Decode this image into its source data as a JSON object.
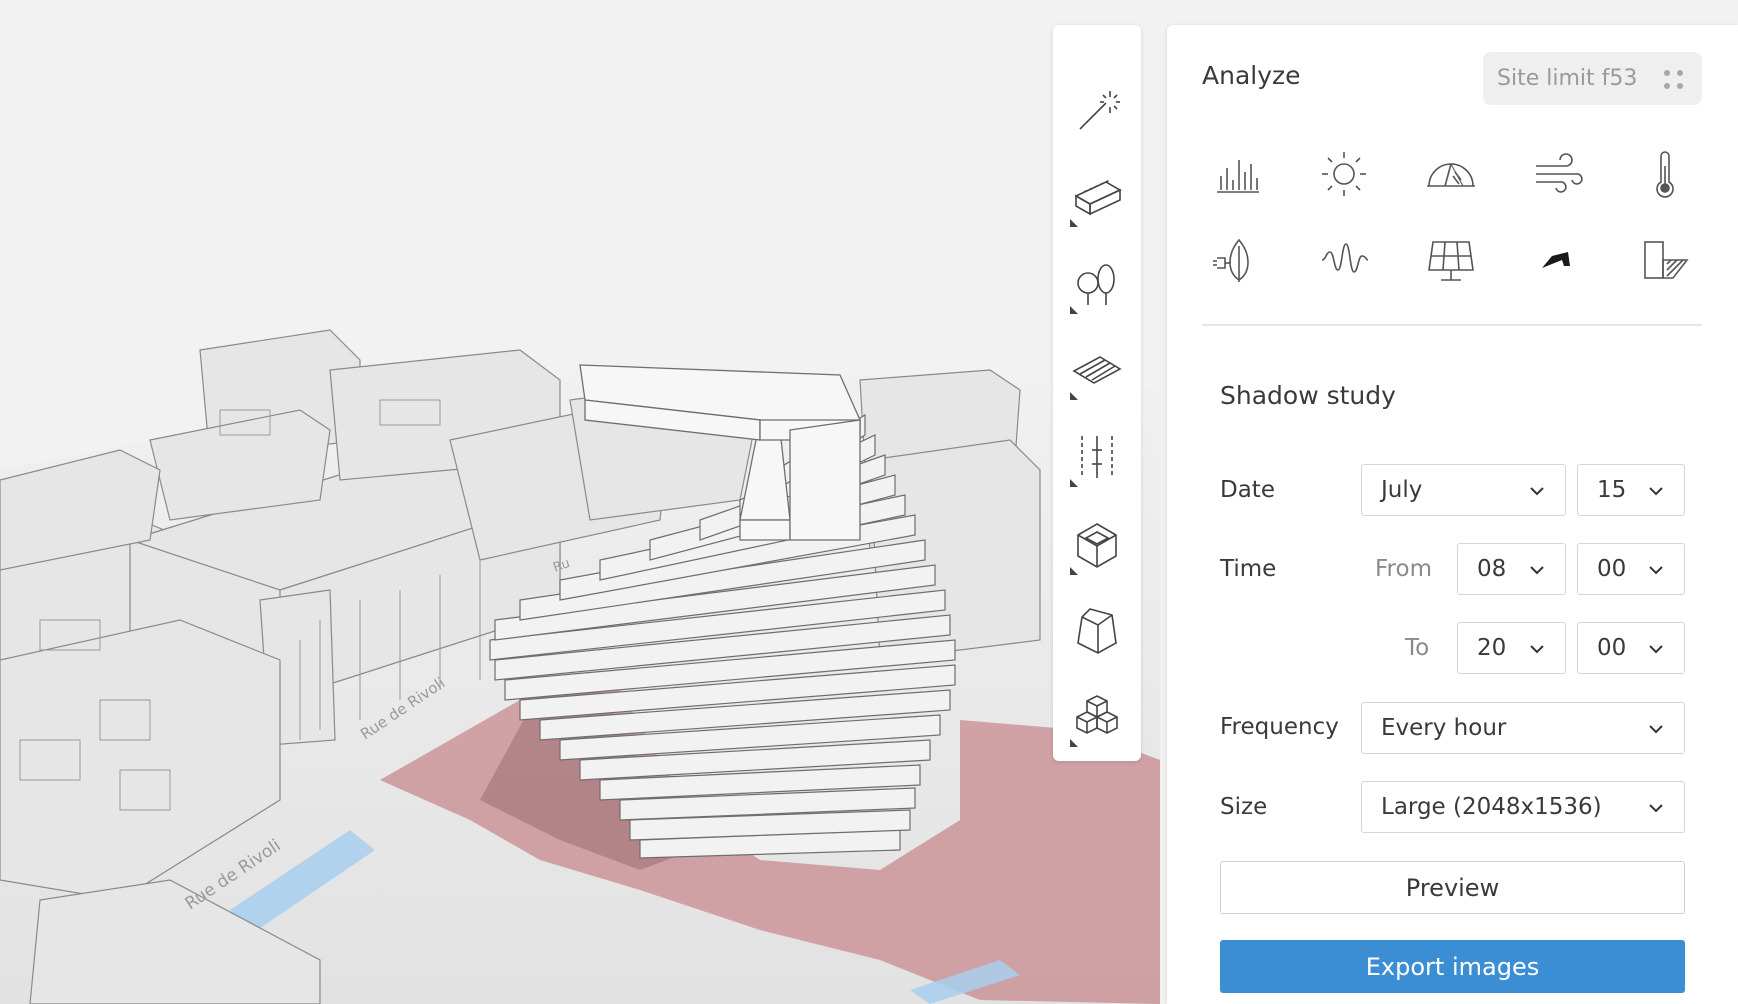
{
  "panel": {
    "title": "Analyze",
    "site_badge": "Site limit f53"
  },
  "toolstrip": {
    "tools": [
      "magic-wand-icon",
      "building-block-icon",
      "trees-icon",
      "terrain-plane-icon",
      "grid-lines-icon",
      "cube-icon",
      "prism-icon",
      "stacked-cubes-icon"
    ]
  },
  "analysis_icons": [
    "bar-chart-icon",
    "sun-icon",
    "sun-path-icon",
    "wind-icon",
    "thermometer-icon",
    "energy-leaf-icon",
    "noise-wave-icon",
    "solar-panel-icon",
    "shadow-icon",
    "daylight-facade-icon"
  ],
  "shadow_study": {
    "title": "Shadow study",
    "date_label": "Date",
    "month": "July",
    "day": "15",
    "time_label": "Time",
    "from_label": "From",
    "from_hour": "08",
    "from_minute": "00",
    "to_label": "To",
    "to_hour": "20",
    "to_minute": "00",
    "frequency_label": "Frequency",
    "frequency": "Every hour",
    "size_label": "Size",
    "size": "Large (2048x1536)",
    "preview_label": "Preview",
    "export_label": "Export images"
  },
  "map": {
    "street_labels": [
      "Rue de Rivoli",
      "Rue de Rivoli",
      "Ru"
    ]
  },
  "colors": {
    "accent": "#3b8dd4",
    "shadow": "#c98f93",
    "building": "#e3e3e3"
  }
}
